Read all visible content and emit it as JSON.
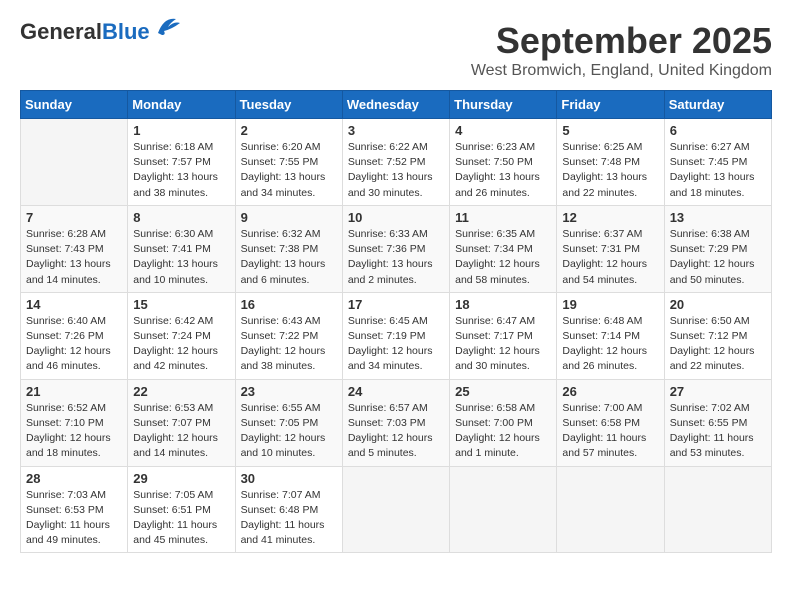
{
  "logo": {
    "general": "General",
    "blue": "Blue"
  },
  "title": "September 2025",
  "location": "West Bromwich, England, United Kingdom",
  "days_of_week": [
    "Sunday",
    "Monday",
    "Tuesday",
    "Wednesday",
    "Thursday",
    "Friday",
    "Saturday"
  ],
  "weeks": [
    [
      {
        "day": "",
        "info": ""
      },
      {
        "day": "1",
        "info": "Sunrise: 6:18 AM\nSunset: 7:57 PM\nDaylight: 13 hours\nand 38 minutes."
      },
      {
        "day": "2",
        "info": "Sunrise: 6:20 AM\nSunset: 7:55 PM\nDaylight: 13 hours\nand 34 minutes."
      },
      {
        "day": "3",
        "info": "Sunrise: 6:22 AM\nSunset: 7:52 PM\nDaylight: 13 hours\nand 30 minutes."
      },
      {
        "day": "4",
        "info": "Sunrise: 6:23 AM\nSunset: 7:50 PM\nDaylight: 13 hours\nand 26 minutes."
      },
      {
        "day": "5",
        "info": "Sunrise: 6:25 AM\nSunset: 7:48 PM\nDaylight: 13 hours\nand 22 minutes."
      },
      {
        "day": "6",
        "info": "Sunrise: 6:27 AM\nSunset: 7:45 PM\nDaylight: 13 hours\nand 18 minutes."
      }
    ],
    [
      {
        "day": "7",
        "info": "Sunrise: 6:28 AM\nSunset: 7:43 PM\nDaylight: 13 hours\nand 14 minutes."
      },
      {
        "day": "8",
        "info": "Sunrise: 6:30 AM\nSunset: 7:41 PM\nDaylight: 13 hours\nand 10 minutes."
      },
      {
        "day": "9",
        "info": "Sunrise: 6:32 AM\nSunset: 7:38 PM\nDaylight: 13 hours\nand 6 minutes."
      },
      {
        "day": "10",
        "info": "Sunrise: 6:33 AM\nSunset: 7:36 PM\nDaylight: 13 hours\nand 2 minutes."
      },
      {
        "day": "11",
        "info": "Sunrise: 6:35 AM\nSunset: 7:34 PM\nDaylight: 12 hours\nand 58 minutes."
      },
      {
        "day": "12",
        "info": "Sunrise: 6:37 AM\nSunset: 7:31 PM\nDaylight: 12 hours\nand 54 minutes."
      },
      {
        "day": "13",
        "info": "Sunrise: 6:38 AM\nSunset: 7:29 PM\nDaylight: 12 hours\nand 50 minutes."
      }
    ],
    [
      {
        "day": "14",
        "info": "Sunrise: 6:40 AM\nSunset: 7:26 PM\nDaylight: 12 hours\nand 46 minutes."
      },
      {
        "day": "15",
        "info": "Sunrise: 6:42 AM\nSunset: 7:24 PM\nDaylight: 12 hours\nand 42 minutes."
      },
      {
        "day": "16",
        "info": "Sunrise: 6:43 AM\nSunset: 7:22 PM\nDaylight: 12 hours\nand 38 minutes."
      },
      {
        "day": "17",
        "info": "Sunrise: 6:45 AM\nSunset: 7:19 PM\nDaylight: 12 hours\nand 34 minutes."
      },
      {
        "day": "18",
        "info": "Sunrise: 6:47 AM\nSunset: 7:17 PM\nDaylight: 12 hours\nand 30 minutes."
      },
      {
        "day": "19",
        "info": "Sunrise: 6:48 AM\nSunset: 7:14 PM\nDaylight: 12 hours\nand 26 minutes."
      },
      {
        "day": "20",
        "info": "Sunrise: 6:50 AM\nSunset: 7:12 PM\nDaylight: 12 hours\nand 22 minutes."
      }
    ],
    [
      {
        "day": "21",
        "info": "Sunrise: 6:52 AM\nSunset: 7:10 PM\nDaylight: 12 hours\nand 18 minutes."
      },
      {
        "day": "22",
        "info": "Sunrise: 6:53 AM\nSunset: 7:07 PM\nDaylight: 12 hours\nand 14 minutes."
      },
      {
        "day": "23",
        "info": "Sunrise: 6:55 AM\nSunset: 7:05 PM\nDaylight: 12 hours\nand 10 minutes."
      },
      {
        "day": "24",
        "info": "Sunrise: 6:57 AM\nSunset: 7:03 PM\nDaylight: 12 hours\nand 5 minutes."
      },
      {
        "day": "25",
        "info": "Sunrise: 6:58 AM\nSunset: 7:00 PM\nDaylight: 12 hours\nand 1 minute."
      },
      {
        "day": "26",
        "info": "Sunrise: 7:00 AM\nSunset: 6:58 PM\nDaylight: 11 hours\nand 57 minutes."
      },
      {
        "day": "27",
        "info": "Sunrise: 7:02 AM\nSunset: 6:55 PM\nDaylight: 11 hours\nand 53 minutes."
      }
    ],
    [
      {
        "day": "28",
        "info": "Sunrise: 7:03 AM\nSunset: 6:53 PM\nDaylight: 11 hours\nand 49 minutes."
      },
      {
        "day": "29",
        "info": "Sunrise: 7:05 AM\nSunset: 6:51 PM\nDaylight: 11 hours\nand 45 minutes."
      },
      {
        "day": "30",
        "info": "Sunrise: 7:07 AM\nSunset: 6:48 PM\nDaylight: 11 hours\nand 41 minutes."
      },
      {
        "day": "",
        "info": ""
      },
      {
        "day": "",
        "info": ""
      },
      {
        "day": "",
        "info": ""
      },
      {
        "day": "",
        "info": ""
      }
    ]
  ]
}
